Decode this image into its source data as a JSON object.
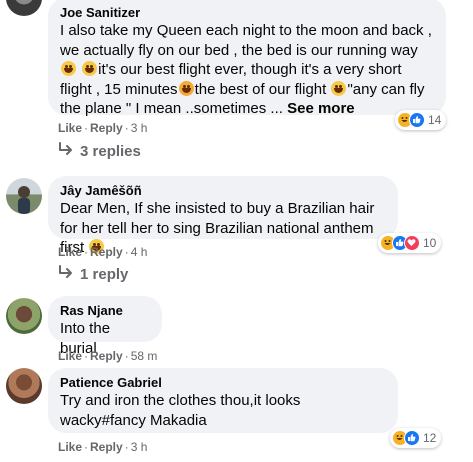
{
  "comments": [
    {
      "author": "Joe Sanitizer",
      "text_parts": [
        "I also take my Queen each night to the moon and back , we actually fly on our bed , the bed is our running way",
        "it's our best flight ever, though it's a very short flight , 15 minutes",
        "the best of our flight ",
        "\"any can fly the plane \" I mean ..sometimes ... "
      ],
      "see_more": "See more",
      "like": "Like",
      "reply": "Reply",
      "time": "3 h",
      "reaction_count": "14",
      "replies_label": "3 replies"
    },
    {
      "author": "Jây Jamêšõñ",
      "text": "Dear Men, If she insisted to buy a Brazilian hair for her tell her to sing Brazilian national anthem first",
      "like": "Like",
      "reply": "Reply",
      "time": "4 h",
      "reaction_count": "10",
      "replies_label": "1 reply"
    },
    {
      "author": "Ras Njane",
      "text": "Into the burial",
      "like": "Like",
      "reply": "Reply",
      "time": "58 m"
    },
    {
      "author": "Patience Gabriel",
      "text": "Try and iron the clothes thou,it looks wacky#fancy Makadia",
      "like": "Like",
      "reply": "Reply",
      "time": "3 h",
      "reaction_count": "12"
    }
  ],
  "colors": {
    "bubble": "#f0f2f5",
    "meta": "#65676b",
    "like": "#1877f2",
    "haha": "#f7b125",
    "love": "#f33e58"
  },
  "icons": {
    "reply_arrow": "reply-arrow-icon",
    "haha": "haha-reaction-icon",
    "like": "like-reaction-icon",
    "love": "love-reaction-icon"
  }
}
